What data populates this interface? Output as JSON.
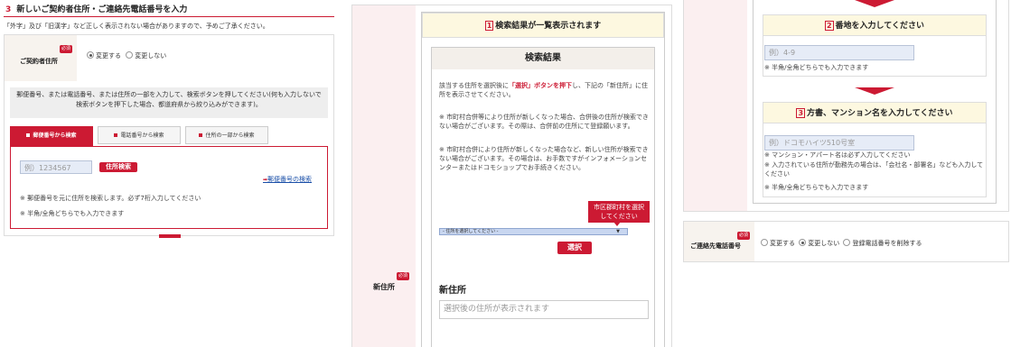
{
  "left": {
    "step_number": "3",
    "step_title": "新しいご契約者住所・ご連絡先電話番号を入力",
    "notice": "「外字」及び「旧漢字」など正しく表示されない場合がありますので、予めご了承ください。",
    "required_label": "必須",
    "contract_address_label": "ご契約者住所",
    "radio_change": "変更する",
    "radio_nochange": "変更しない",
    "instructions": "郵便番号、または電話番号、または住所の一部を入力して、検索ボタンを押してください(何も入力しないで検索ボタンを押下した場合、都道府県から絞り込みができます)。",
    "tabs": [
      "郵便番号から検索",
      "電話番号から検索",
      "住所の一部から検索"
    ],
    "postal_placeholder": "例）1234567",
    "address_search_button": "住所検索",
    "postal_search_link": "郵便番号の検索",
    "notes": [
      "※ 郵便番号を元に住所を検索します。必ず7桁入力してください",
      "※ 半角/全角どちらでも入力できます"
    ]
  },
  "middle": {
    "step1_num": "1",
    "step1_title": "検索結果が一覧表示されます",
    "results_title": "検索結果",
    "desc_prefix": "該当する住所を選択後に",
    "desc_strong": "「選択」ボタンを押下",
    "desc_suffix": "し、下記の「新住所」に住所を表示させてください。",
    "note1": "※ 市町村合併等により住所が新しくなった場合、合併後の住所が検索できない場合がございます。その際は、合併前の住所にて登録願います。",
    "note2": "※ 市町村合併により住所が新しくなった場合など、新しい住所が検索できない場合がございます。その場合は、お手数ですがインフォメーションセンターまたはドコモショップでお手続きください。",
    "tooltip": "市区郡町村を選択してください",
    "select_value": "- 住所を選択してください -",
    "select_button": "選択",
    "required_label": "必須",
    "new_address_label": "新住所",
    "new_address_title": "新住所",
    "new_address_placeholder": "選択後の住所が表示されます"
  },
  "right": {
    "step2_num": "2",
    "step2_title": "番地を入力してください",
    "banchi_placeholder": "例）4-9",
    "banchi_note": "※ 半角/全角どちらでも入力できます",
    "step3_num": "3",
    "step3_title": "方書、マンション名を入力してください",
    "building_placeholder": "例）ドコモハイツ510号室",
    "building_notes": [
      "※ マンション・アパート名は必ず入力してください",
      "※ 入力されている住所が勤務先の場合は、「会社名・部署名」なども入力してください",
      "※ 半角/全角どちらでも入力できます"
    ],
    "required_label": "必須",
    "phone_label": "ご連絡先電話番号",
    "phone_options": [
      "変更する",
      "変更しない",
      "登録電話番号を削除する"
    ]
  },
  "colors": {
    "accent": "#cc1a33",
    "panel_yellow": "#fdf8e0",
    "input_blue": "#e6ecf7"
  }
}
